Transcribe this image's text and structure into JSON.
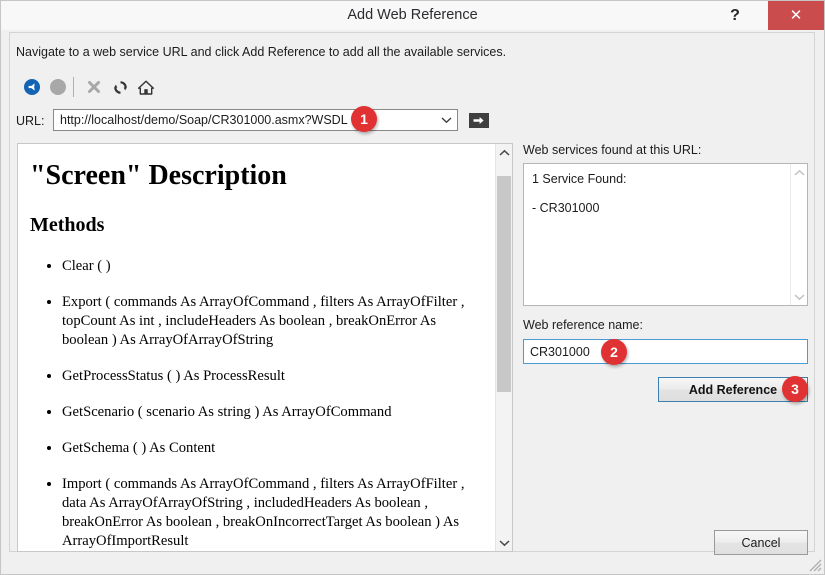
{
  "window": {
    "title": "Add Web Reference",
    "help_icon": "?",
    "close_icon": "✕"
  },
  "instructions": "Navigate to a web service URL and click Add Reference to add all the available services.",
  "toolbar": {
    "buttons": [
      {
        "name": "back-icon",
        "label": "Back",
        "enabled": true
      },
      {
        "name": "forward-icon",
        "label": "Forward",
        "enabled": false
      },
      {
        "name": "stop-icon",
        "label": "Stop",
        "enabled": false
      },
      {
        "name": "refresh-icon",
        "label": "Refresh",
        "enabled": true
      },
      {
        "name": "home-icon",
        "label": "Home",
        "enabled": true
      }
    ]
  },
  "url_bar": {
    "label": "URL:",
    "value": "http://localhost/demo/Soap/CR301000.asmx?WSDL",
    "placeholder": "",
    "dropdown_icon": "chevron-down-icon",
    "go_icon": "go-arrow-icon"
  },
  "browser": {
    "doc_title": "\"Screen\" Description",
    "doc_subtitle": "Methods",
    "methods": [
      "Clear ( )",
      "Export ( commands As ArrayOfCommand ,  filters As ArrayOfFilter ,  topCount As int ,  includeHeaders As boolean ,  breakOnError As boolean ) As ArrayOfArrayOfString",
      "GetProcessStatus ( ) As ProcessResult",
      "GetScenario ( scenario As string ) As ArrayOfCommand",
      "GetSchema ( ) As Content",
      "Import ( commands As ArrayOfCommand ,  filters As ArrayOfFilter ,  data As ArrayOfArrayOfString ,  includedHeaders As boolean ,  breakOnError As boolean ,  breakOnIncorrectTarget As boolean ) As ArrayOfImportResult"
    ],
    "scrollbar": {
      "up_icon": "chevron-up-icon",
      "down_icon": "chevron-down-icon"
    }
  },
  "services_panel": {
    "label": "Web services found at this URL:",
    "found_text": "1 Service Found:",
    "items": [
      "- CR301000"
    ],
    "scrollbar": {
      "up_icon": "chevron-up-icon",
      "down_icon": "chevron-down-icon"
    }
  },
  "reference_name": {
    "label": "Web reference name:",
    "value": "CR301000",
    "placeholder": ""
  },
  "buttons": {
    "add_reference": "Add Reference",
    "cancel": "Cancel"
  },
  "annotations": {
    "badge_1": "1",
    "badge_2": "2",
    "badge_3": "3",
    "color": "#e03232"
  }
}
